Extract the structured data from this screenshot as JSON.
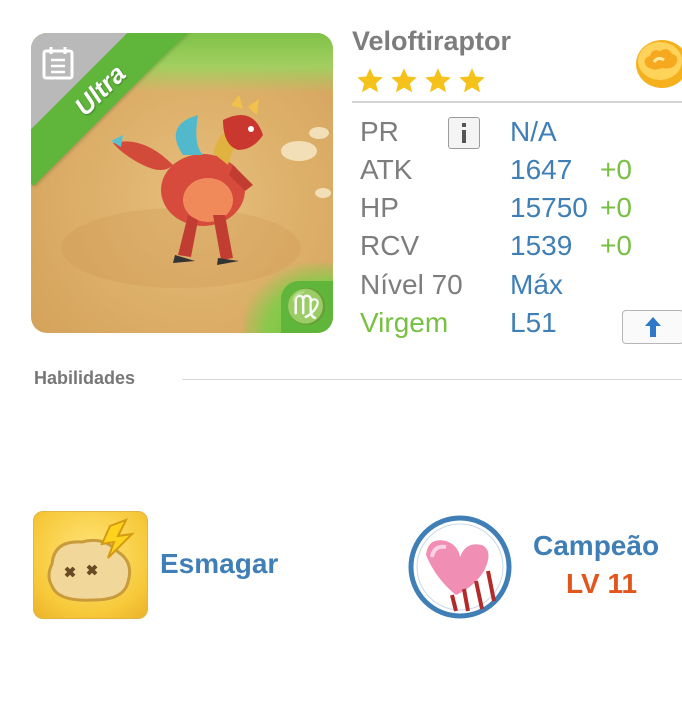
{
  "monster": {
    "name": "Veloftiraptor",
    "rarity": "Ultra",
    "stars": 4,
    "sign_symbol": "♍"
  },
  "stats": {
    "pr_label": "PR",
    "pr_value": "N/A",
    "atk_label": "ATK",
    "atk_value": "1647",
    "atk_bonus": "+0",
    "hp_label": "HP",
    "hp_value": "15750",
    "hp_bonus": "+0",
    "rcv_label": "RCV",
    "rcv_value": "1539",
    "rcv_bonus": "+0",
    "level_label": "Nível 70",
    "level_value": "Máx",
    "sign_label": "Virgem",
    "sign_value": "L51"
  },
  "abilities": {
    "section_label": "Habilidades",
    "skill": {
      "name": "Esmagar",
      "icon": "smash-icon"
    },
    "leader": {
      "name": "Campeão",
      "level": "LV 11",
      "icon": "champion-heart-icon"
    }
  },
  "colors": {
    "accent_blue": "#3f7fb6",
    "accent_green": "#78c042",
    "ribbon_green": "#5fb63a",
    "level_orange": "#e2561b",
    "star_yellow": "#f5c21b"
  }
}
